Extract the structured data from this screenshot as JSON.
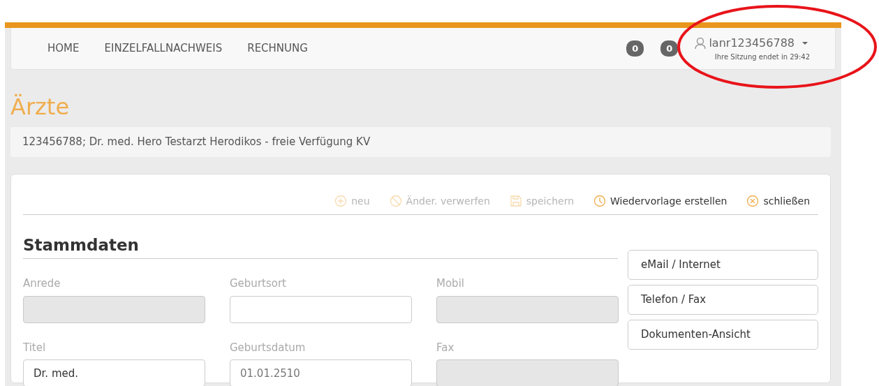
{
  "nav": {
    "items": [
      {
        "label": "HOME"
      },
      {
        "label": "EINZELFALLNACHWEIS"
      },
      {
        "label": "RECHNUNG"
      }
    ],
    "badges": [
      "0",
      "0"
    ],
    "user": {
      "name": "lanr123456788",
      "session": "Ihre Sitzung endet in 29:42"
    }
  },
  "page_title": "Ärzte",
  "info": "123456788; Dr. med. Hero Testarzt Herodikos - freie Verfügung KV",
  "toolbar": [
    {
      "kind": "plus",
      "label": "neu",
      "disabled": true
    },
    {
      "kind": "ban",
      "label": "Änder. verwerfen",
      "disabled": true
    },
    {
      "kind": "save",
      "label": "speichern",
      "disabled": true
    },
    {
      "kind": "clock",
      "label": "Wiedervorlage erstellen",
      "disabled": false
    },
    {
      "kind": "close",
      "label": "schließen",
      "disabled": false
    }
  ],
  "section": {
    "title": "Stammdaten",
    "fields": [
      {
        "label": "Anrede",
        "disabled": true
      },
      {
        "label": "Geburtsort",
        "disabled": false
      },
      {
        "label": "Mobil",
        "disabled": true
      },
      {
        "label": "Titel",
        "value": "Dr. med.",
        "disabled": false
      },
      {
        "label": "Geburtsdatum",
        "placeholder": "01.01.2510",
        "disabled": false
      },
      {
        "label": "Fax",
        "disabled": true
      }
    ]
  },
  "side_buttons": [
    "eMail / Internet",
    "Telefon / Fax",
    "Dokumenten-Ansicht"
  ]
}
